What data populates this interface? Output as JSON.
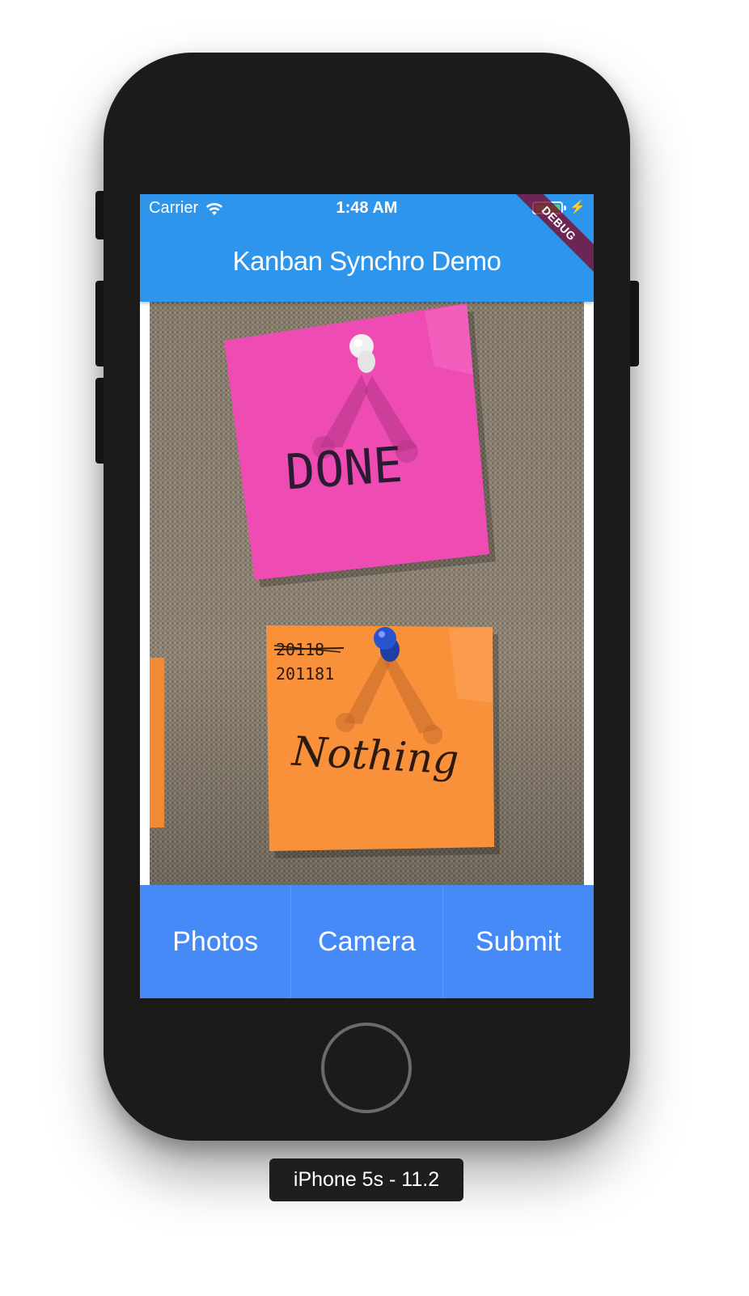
{
  "status_bar": {
    "carrier": "Carrier",
    "time": "1:48 AM",
    "battery_color": "#4cd964"
  },
  "app_bar": {
    "title": "Kanban Synchro Demo",
    "background": "#2d96ec"
  },
  "debug_banner": {
    "label": "DEBUG"
  },
  "photo": {
    "notes": [
      {
        "text": "DONE",
        "color": "#ef4bb1",
        "pin": "white"
      },
      {
        "text": "Nothing",
        "color": "#f9913a",
        "pin": "blue",
        "extra_lines": [
          "20118",
          "201181"
        ]
      }
    ]
  },
  "buttons": [
    {
      "label": "Photos"
    },
    {
      "label": "Camera"
    },
    {
      "label": "Submit"
    }
  ],
  "button_bar_color": "#468af8",
  "device_label": "iPhone 5s - 11.2",
  "icons": [
    "wifi-icon",
    "battery-icon",
    "charging-bolt-icon"
  ]
}
